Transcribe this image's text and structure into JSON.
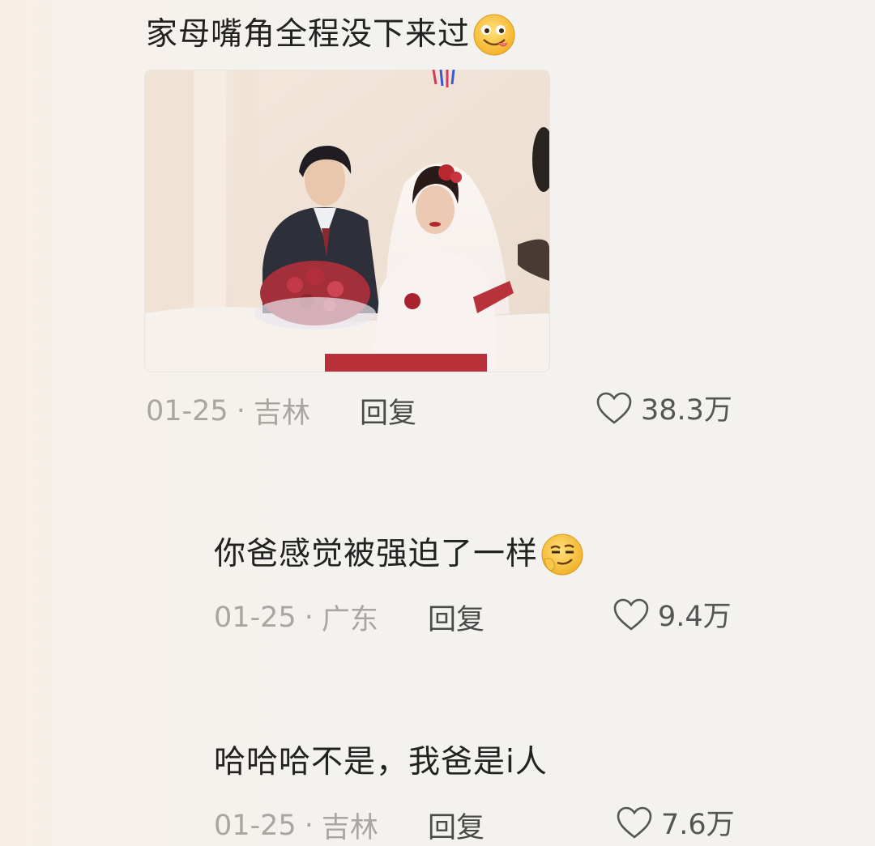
{
  "comments": [
    {
      "text": "家母嘴角全程没下来过",
      "emoji": "yummy-face-emoji",
      "date": "01-25",
      "location": "吉林",
      "reply_label": "回复",
      "likes": "38.3万",
      "has_photo": true
    },
    {
      "text": "你爸感觉被强迫了一样",
      "emoji": "smirking-face-emoji",
      "date": "01-25",
      "location": "广东",
      "reply_label": "回复",
      "likes": "9.4万"
    },
    {
      "text": "哈哈哈不是，我爸是i人",
      "date": "01-25",
      "location": "吉林",
      "reply_label": "回复",
      "likes": "7.6万"
    }
  ],
  "separator": "·",
  "icons": {
    "like": "heart-outline-icon"
  },
  "colors": {
    "background": "#f3f2ef",
    "meta_text": "#a9a6a2",
    "body_text": "#222222"
  }
}
